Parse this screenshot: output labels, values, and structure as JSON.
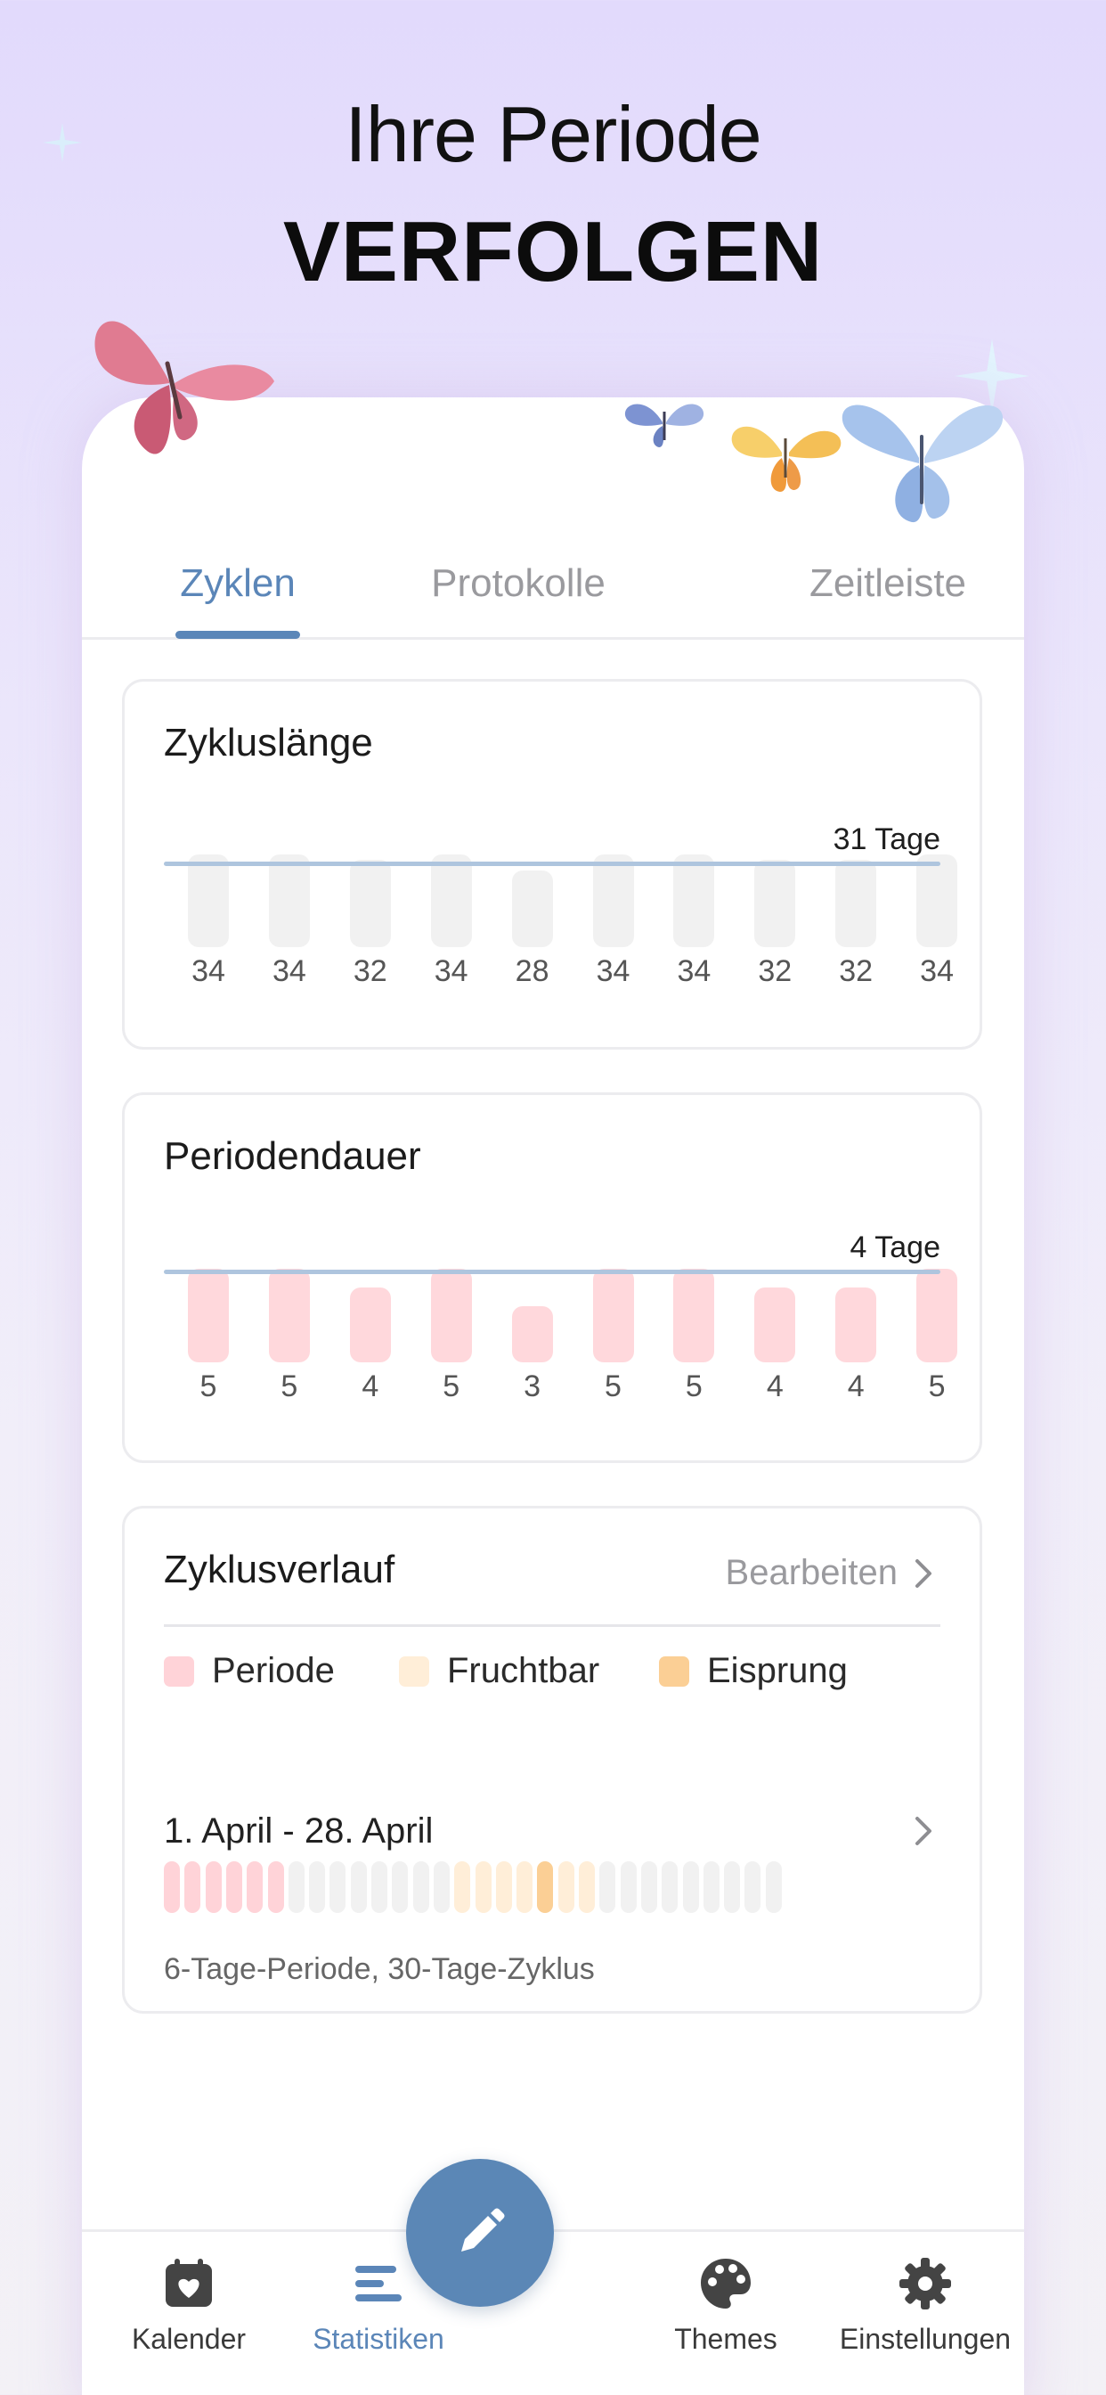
{
  "hero": {
    "line1": "Ihre Periode",
    "line2": "VERFOLGEN"
  },
  "tabs": [
    {
      "label": "Zyklen",
      "active": true
    },
    {
      "label": "Protokolle",
      "active": false
    },
    {
      "label": "Zeitleiste",
      "active": false
    }
  ],
  "cycle_length": {
    "title": "Zykluslänge",
    "average_label": "31 Tage",
    "values": [
      "34",
      "34",
      "32",
      "34",
      "28",
      "34",
      "34",
      "32",
      "32",
      "34"
    ]
  },
  "period_duration": {
    "title": "Periodendauer",
    "average_label": "4 Tage",
    "values": [
      "5",
      "5",
      "4",
      "5",
      "3",
      "5",
      "5",
      "4",
      "4",
      "5"
    ]
  },
  "cycle_history": {
    "title": "Zyklusverlauf",
    "edit_label": "Bearbeiten",
    "legend": [
      {
        "label": "Periode",
        "color": "#ffd3d8"
      },
      {
        "label": "Fruchtbar",
        "color": "#ffeed8"
      },
      {
        "label": "Eisprung",
        "color": "#fbcf95"
      }
    ],
    "cycle": {
      "range": "1. April - 28. April",
      "summary": "6-Tage-Periode, 30-Tage-Zyklus",
      "period_days": 6,
      "total_days": 30,
      "fertile_days": [
        15,
        16,
        17,
        18,
        20,
        21
      ],
      "ovulation_day": 19
    }
  },
  "colors": {
    "accent": "#5b86b8",
    "period": "#ffd3d8",
    "fertile": "#ffeed8",
    "ovulation": "#fbcf95",
    "neutral_day": "#f1f1f1"
  },
  "nav": {
    "items": [
      {
        "label": "Kalender",
        "icon": "calendar-heart-icon",
        "active": false
      },
      {
        "label": "Statistiken",
        "icon": "statistics-icon",
        "active": true
      },
      {
        "label": "Themes",
        "icon": "palette-icon",
        "active": false
      },
      {
        "label": "Einstellungen",
        "icon": "gear-icon",
        "active": false
      }
    ],
    "fab_icon": "pencil-icon"
  }
}
